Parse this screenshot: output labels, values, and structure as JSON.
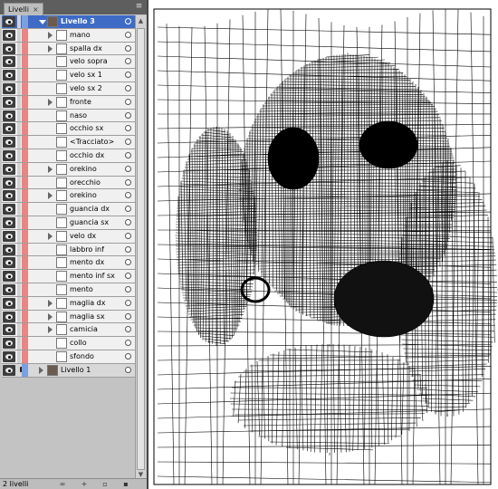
{
  "panel": {
    "tab_label": "Livelli",
    "tab_close": "×",
    "menu_icon": "panel-menu-icon",
    "footer": {
      "layer_count": "2 livelli"
    }
  },
  "layers": {
    "group": {
      "name": "Livello 3"
    },
    "items": [
      {
        "name": "mano",
        "has_arrow": true
      },
      {
        "name": "spalla dx",
        "has_arrow": true
      },
      {
        "name": "velo sopra",
        "has_arrow": false
      },
      {
        "name": "velo sx 1",
        "has_arrow": false
      },
      {
        "name": "velo sx 2",
        "has_arrow": false
      },
      {
        "name": "fronte",
        "has_arrow": true
      },
      {
        "name": "naso",
        "has_arrow": false
      },
      {
        "name": "occhio sx",
        "has_arrow": false
      },
      {
        "name": "<Tracciato>",
        "has_arrow": false
      },
      {
        "name": "occhio dx",
        "has_arrow": false
      },
      {
        "name": "orekino",
        "has_arrow": true
      },
      {
        "name": "orecchio",
        "has_arrow": false
      },
      {
        "name": "orekino",
        "has_arrow": true
      },
      {
        "name": "guancia dx",
        "has_arrow": false
      },
      {
        "name": "guancia sx",
        "has_arrow": false
      },
      {
        "name": "velo dx",
        "has_arrow": true
      },
      {
        "name": "labbro inf",
        "has_arrow": false
      },
      {
        "name": "mento dx",
        "has_arrow": false
      },
      {
        "name": "mento inf sx",
        "has_arrow": false
      },
      {
        "name": "mento",
        "has_arrow": false
      },
      {
        "name": "maglia dx",
        "has_arrow": true
      },
      {
        "name": "maglia sx",
        "has_arrow": true
      },
      {
        "name": "camicia",
        "has_arrow": true
      },
      {
        "name": "collo",
        "has_arrow": false
      },
      {
        "name": "sfondo",
        "has_arrow": false
      }
    ],
    "bottom": {
      "name": "Livello 1"
    }
  },
  "colors": {
    "selected": "#3d6bc6",
    "panel_bg": "#c3c3c3",
    "canvas_bg": "#ffffff",
    "layer_color_red": "#e88585",
    "layer_color_blue": "#7aa0e0"
  }
}
